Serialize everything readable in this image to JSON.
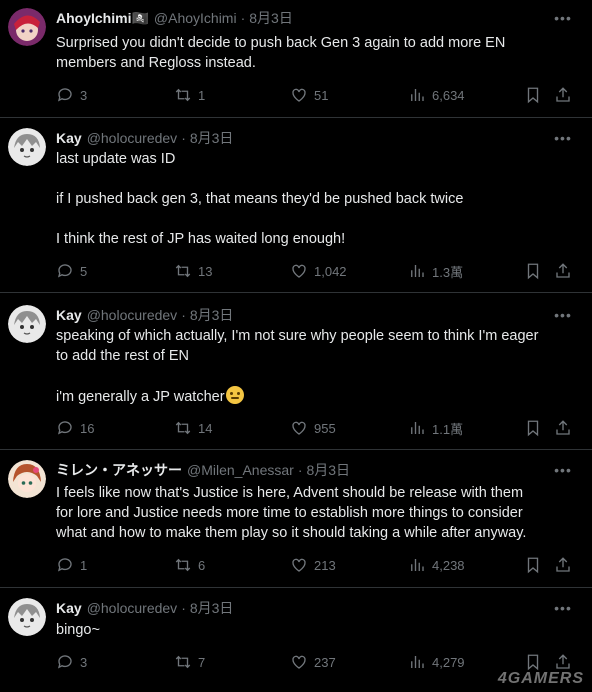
{
  "tweets": [
    {
      "name": "AhoyIchimi🏴‍☠️",
      "handle": "@AhoyIchimi",
      "dot": "·",
      "date": "8月3日",
      "lines": [
        "Surprised you didn't decide to push back Gen 3 again to add more EN",
        "members and Regloss instead."
      ],
      "replies": "3",
      "retweets": "1",
      "likes": "51",
      "views": "6,634"
    },
    {
      "name": "Kay",
      "handle": "@holocuredev",
      "dot": "·",
      "date": "8月3日",
      "lines": [
        "last update was ID",
        "",
        "if I pushed back gen 3, that means they'd be pushed back twice",
        "",
        "I think the rest of JP has waited long enough!"
      ],
      "replies": "5",
      "retweets": "13",
      "likes": "1,042",
      "views": "1.3萬"
    },
    {
      "name": "Kay",
      "handle": "@holocuredev",
      "dot": "·",
      "date": "8月3日",
      "lines": [
        "speaking of which actually, I'm not sure why people seem to think I'm eager",
        "to add the rest of EN",
        "",
        "i'm generally a JP watcher"
      ],
      "replies": "16",
      "retweets": "14",
      "likes": "955",
      "views": "1.1萬"
    },
    {
      "name": "ミレン・アネッサー",
      "handle": "@Milen_Anessar",
      "dot": "·",
      "date": "8月3日",
      "lines": [
        "I feels like now that's Justice is here, Advent should be release with them",
        "for lore and Justice needs more time to establish more things to consider",
        "what and how to make them play so it should taking a while after anyway."
      ],
      "replies": "1",
      "retweets": "6",
      "likes": "213",
      "views": "4,238"
    },
    {
      "name": "Kay",
      "handle": "@holocuredev",
      "dot": "·",
      "date": "8月3日",
      "lines": [
        "bingo~"
      ],
      "replies": "3",
      "retweets": "7",
      "likes": "237",
      "views": "4,279"
    }
  ],
  "icons": {
    "reply": "reply-icon",
    "retweet": "retweet-icon",
    "like": "heart-icon",
    "views": "views-icon",
    "bookmark": "bookmark-icon",
    "share": "share-icon",
    "more": "more-icon",
    "emoji": "slightly-smiling-emoji"
  },
  "colors": {
    "background": "#000000",
    "text": "#e7e9ea",
    "muted": "#71767b",
    "divider": "#2f3336"
  },
  "watermark": "4GAMERS"
}
